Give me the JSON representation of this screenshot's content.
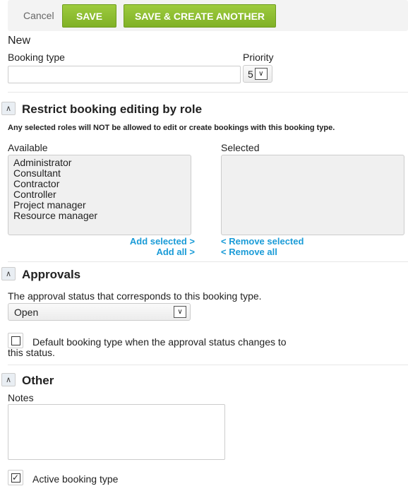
{
  "toolbar": {
    "cancel": "Cancel",
    "save": "SAVE",
    "save_another": "SAVE & CREATE ANOTHER"
  },
  "form": {
    "title": "New",
    "booking_type_label": "Booking type",
    "booking_type_value": "",
    "priority_label": "Priority",
    "priority_value": "5"
  },
  "restrict": {
    "title": "Restrict booking editing by role",
    "note": "Any selected roles will NOT be allowed to edit or create bookings with this booking type.",
    "available_label": "Available",
    "selected_label": "Selected",
    "available": [
      "Administrator",
      "Consultant",
      "Contractor",
      "Controller",
      "Project manager",
      "Resource manager"
    ],
    "selected": [],
    "add_selected": "Add selected >",
    "add_all": "Add all >",
    "remove_selected": "< Remove selected",
    "remove_all": "< Remove all"
  },
  "approvals": {
    "title": "Approvals",
    "desc": "The approval status that corresponds to this booking type.",
    "status_value": "Open",
    "default_label": "Default booking type when the approval status changes to this status.",
    "default_checked": false
  },
  "other": {
    "title": "Other",
    "notes_label": "Notes",
    "notes_value": "",
    "active_label": "Active booking type",
    "active_checked": true
  },
  "colors": {
    "accent_green": "#8bbd31",
    "link_blue": "#1a9bd7"
  }
}
